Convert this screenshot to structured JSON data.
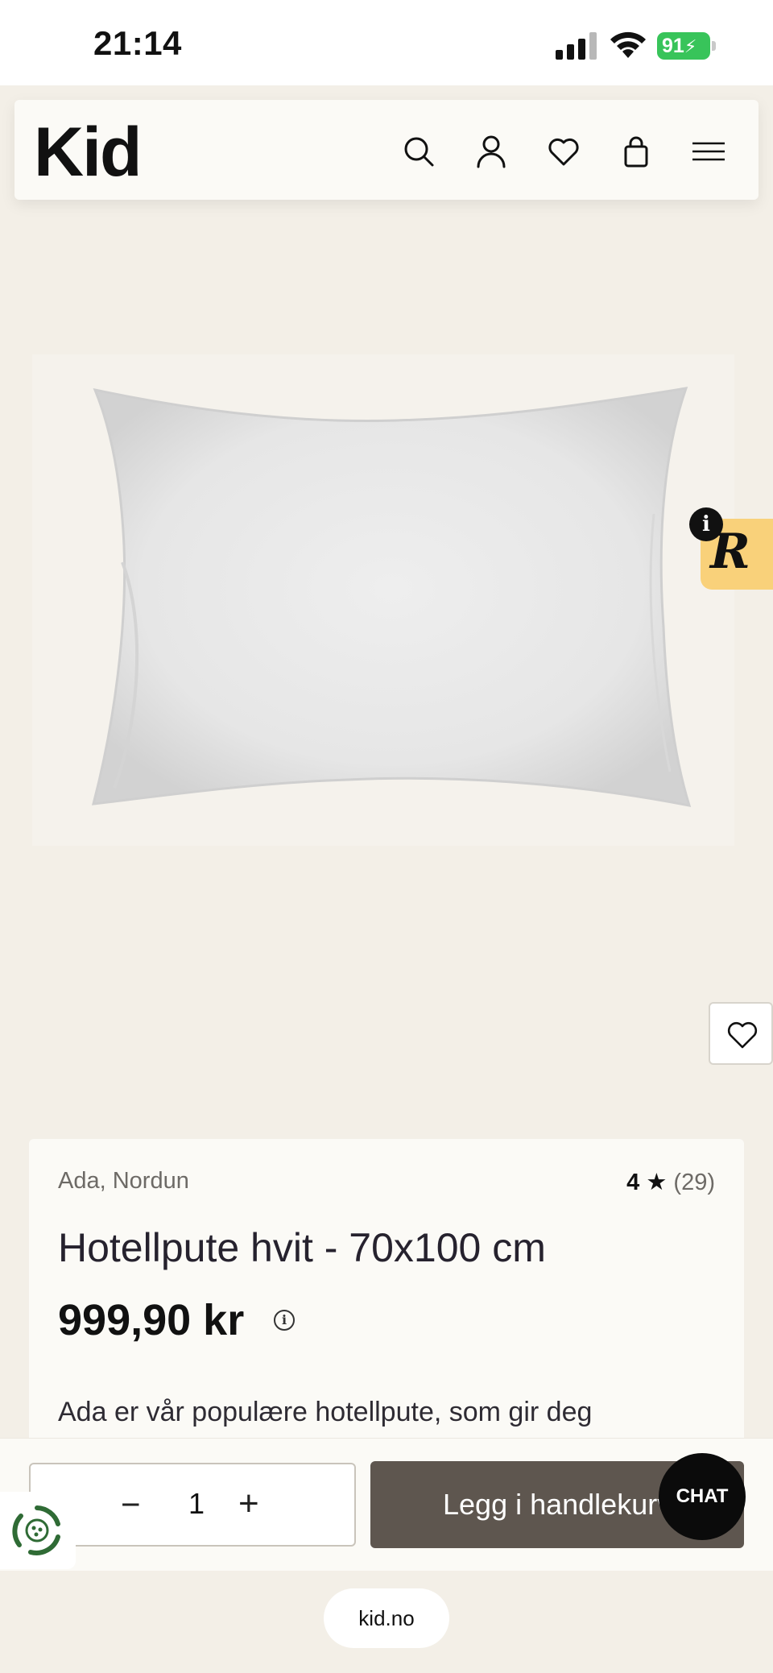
{
  "status_bar": {
    "time": "21:14",
    "battery": "91"
  },
  "header": {
    "logo": "Kid",
    "icons": [
      "search-icon",
      "account-icon",
      "wishlist-icon",
      "cart-icon",
      "menu-icon"
    ]
  },
  "product": {
    "brand": "Ada, Nordun",
    "rating": {
      "score": "4",
      "star": "★",
      "count": "(29)"
    },
    "title": "Hotellpute hvit - 70x100 cm",
    "price": "999,90 kr",
    "price_info_icon": "i",
    "description": "Ada er vår populære hotellpute, som gir deg"
  },
  "review_badge": {
    "letter": "R",
    "info": "i"
  },
  "actions": {
    "quantity": "1",
    "minus": "−",
    "plus": "+",
    "add_to_cart_label": "Legg i handlekurv",
    "chat_label": "CHAT"
  },
  "browser": {
    "url": "kid.no"
  },
  "colors": {
    "background": "#f3efe7",
    "add_button": "#5e564f",
    "battery": "#38c45a",
    "review_badge": "#f9d17a"
  }
}
